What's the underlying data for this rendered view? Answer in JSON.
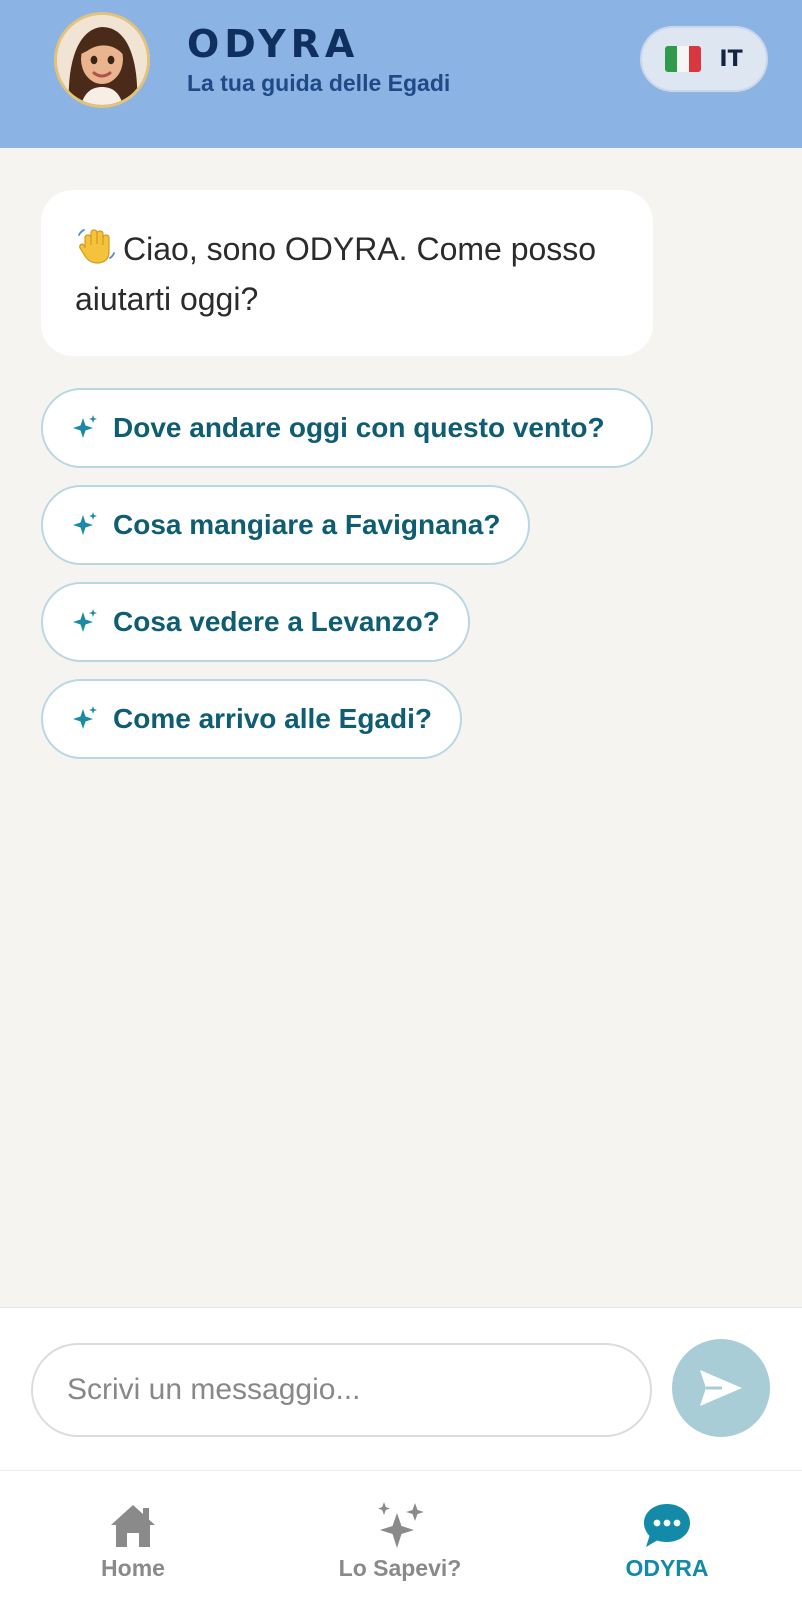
{
  "header": {
    "title": "ODYRA",
    "subtitle": "La tua guida delle Egadi",
    "avatar_icon": "assistant-avatar",
    "language": {
      "code": "IT",
      "flag_icon": "italy-flag-icon"
    }
  },
  "chat": {
    "greeting_icon": "waving-hand-icon",
    "greeting": "Ciao, sono ODYRA. Come posso aiutarti oggi?",
    "suggestions": [
      {
        "icon": "sparkle-icon",
        "label": "Dove andare oggi con questo vento?"
      },
      {
        "icon": "sparkle-icon",
        "label": "Cosa mangiare a Favignana?"
      },
      {
        "icon": "sparkle-icon",
        "label": "Cosa vedere a Levanzo?"
      },
      {
        "icon": "sparkle-icon",
        "label": "Come arrivo alle Egadi?"
      }
    ]
  },
  "composer": {
    "placeholder": "Scrivi un messaggio...",
    "value": "",
    "send_icon": "send-icon"
  },
  "tabs": [
    {
      "label": "Home",
      "icon": "home-icon",
      "active": false
    },
    {
      "label": "Lo Sapevi?",
      "icon": "sparkles-icon",
      "active": false
    },
    {
      "label": "ODYRA",
      "icon": "chat-bubble-icon",
      "active": true
    }
  ],
  "colors": {
    "header_bg": "#8bb4e5",
    "accent": "#138aa7",
    "chip_text": "#0f5d73",
    "send_button": "#a9cdd6",
    "page_bg": "#f5f4f1"
  }
}
